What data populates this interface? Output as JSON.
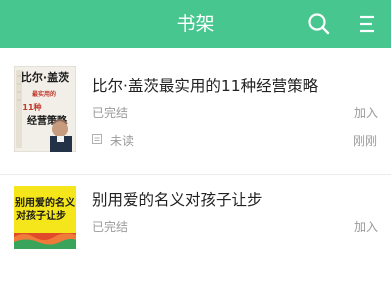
{
  "header": {
    "title": "书架",
    "background": "#47c690",
    "search_icon": "search-icon",
    "menu_icon": "menu-icon"
  },
  "books": [
    {
      "title": "比尔·盖茨最实用的11种经营策略",
      "status": "已完结",
      "action": "加入",
      "read_status": "未读",
      "read_time": "刚刚",
      "cover": {
        "line1": "比尔·盖茨",
        "line2": "最实用的",
        "line3": "经营策略",
        "line4": "11种"
      }
    },
    {
      "title": "别用爱的名义对孩子让步",
      "status": "已完结",
      "action": "加入",
      "cover": {
        "line1": "别用爱的名义",
        "line2": "对孩子让步"
      }
    }
  ]
}
